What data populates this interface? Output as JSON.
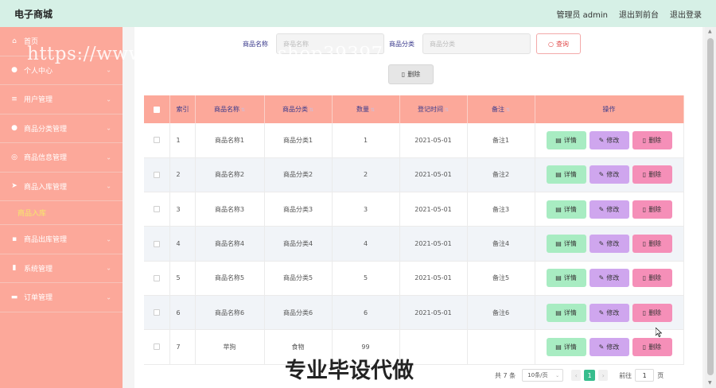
{
  "app": {
    "title": "电子商城",
    "user_label": "管理员 admin",
    "to_front": "退出到前台",
    "logout": "退出登录"
  },
  "sidebar": {
    "items": [
      {
        "label": "首页",
        "icon": "home-icon",
        "glyph": "⌂",
        "chevron": false
      },
      {
        "label": "个人中心",
        "icon": "user-icon",
        "glyph": "●",
        "chevron": true
      },
      {
        "label": "用户管理",
        "icon": "list-icon",
        "glyph": "≡",
        "chevron": true
      },
      {
        "label": "商品分类管理",
        "icon": "person-icon",
        "glyph": "●",
        "chevron": true
      },
      {
        "label": "商品信息管理",
        "icon": "globe-icon",
        "glyph": "◎",
        "chevron": true
      },
      {
        "label": "商品入库管理",
        "icon": "send-icon",
        "glyph": "➤",
        "chevron": true,
        "expanded": true
      },
      {
        "label": "商品出库管理",
        "icon": "box-icon",
        "glyph": "▪",
        "chevron": true
      },
      {
        "label": "系统管理",
        "icon": "clipboard-icon",
        "glyph": "▮",
        "chevron": true
      },
      {
        "label": "订单管理",
        "icon": "briefcase-icon",
        "glyph": "▬",
        "chevron": true
      }
    ],
    "subitem": "商品入库"
  },
  "search": {
    "name_label": "商品名称",
    "name_placeholder": "商品名称",
    "category_label": "商品分类",
    "category_placeholder": "商品分类",
    "query_button": "查询",
    "delete_button": "删除"
  },
  "table": {
    "headers": {
      "index": "索引",
      "name": "商品名称",
      "category": "商品分类",
      "quantity": "数量",
      "date": "登记时间",
      "note": "备注",
      "actions": "操作"
    },
    "action_labels": {
      "detail": "详情",
      "edit": "修改",
      "delete": "删除"
    },
    "rows": [
      {
        "index": "1",
        "name": "商品名称1",
        "category": "商品分类1",
        "quantity": "1",
        "date": "2021-05-01",
        "note": "备注1"
      },
      {
        "index": "2",
        "name": "商品名称2",
        "category": "商品分类2",
        "quantity": "2",
        "date": "2021-05-01",
        "note": "备注2"
      },
      {
        "index": "3",
        "name": "商品名称3",
        "category": "商品分类3",
        "quantity": "3",
        "date": "2021-05-01",
        "note": "备注3"
      },
      {
        "index": "4",
        "name": "商品名称4",
        "category": "商品分类4",
        "quantity": "4",
        "date": "2021-05-01",
        "note": "备注4"
      },
      {
        "index": "5",
        "name": "商品名称5",
        "category": "商品分类5",
        "quantity": "5",
        "date": "2021-05-01",
        "note": "备注5"
      },
      {
        "index": "6",
        "name": "商品名称6",
        "category": "商品分类6",
        "quantity": "6",
        "date": "2021-05-01",
        "note": "备注6"
      },
      {
        "index": "7",
        "name": "苹狗",
        "category": "食物",
        "quantity": "99",
        "date": "",
        "note": ""
      }
    ]
  },
  "pagination": {
    "total": "共 7 条",
    "page_size": "10条/页",
    "current_page": "1",
    "goto_label": "前往",
    "goto_value": "1",
    "page_unit": "页"
  },
  "overlay": {
    "watermark": "https://www.huzhan.com/ishop39397",
    "caption": "专业毕设代做"
  },
  "colors": {
    "topbar": "#d6f0e6",
    "sidebar": "#fca89a",
    "header_row": "#fca89a",
    "detail_button": "#a8ecc2",
    "edit_button": "#cfa6ee",
    "delete_button": "#f58fb8",
    "active_page": "#37bd8d"
  }
}
